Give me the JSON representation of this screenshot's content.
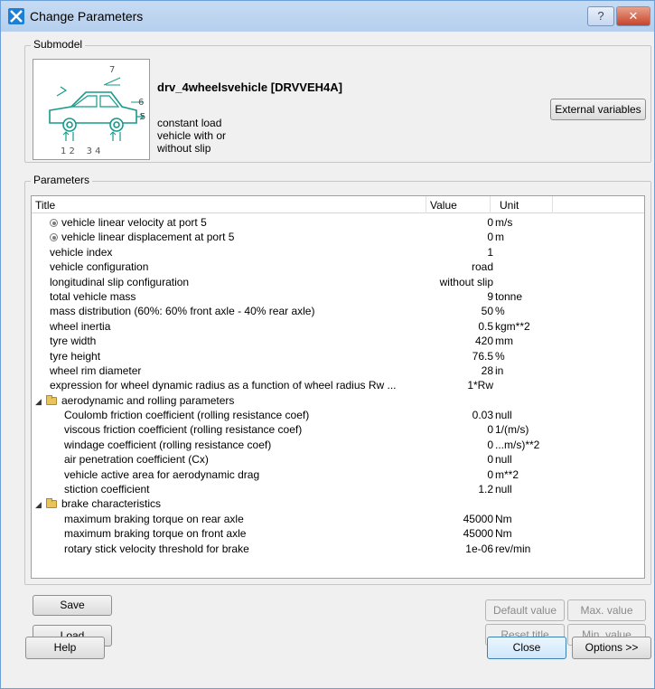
{
  "window": {
    "title": "Change Parameters",
    "help_label": "?",
    "close_label": "✕"
  },
  "submodel": {
    "group_label": "Submodel",
    "name": "drv_4wheelsvehicle [DRVVEH4A]",
    "description": [
      "constant load",
      "vehicle with or",
      "without slip"
    ],
    "diagram_labels": {
      "p7": "7",
      "p6": "6",
      "p5": "5",
      "bottom": "1 2    3 4"
    },
    "external_variables_label": "External variables"
  },
  "parameters": {
    "group_label": "Parameters",
    "columns": {
      "title": "Title",
      "value": "Value",
      "unit": "Unit"
    },
    "rows": [
      {
        "title": "vehicle linear velocity at port 5",
        "value": "0",
        "unit": "m/s",
        "icon": "radio",
        "indent": 1
      },
      {
        "title": "vehicle linear displacement at port 5",
        "value": "0",
        "unit": "m",
        "icon": "radio",
        "indent": 1
      },
      {
        "title": "vehicle index",
        "value": "1",
        "unit": "",
        "indent": 1
      },
      {
        "title": "vehicle configuration",
        "value": "road",
        "unit": "",
        "indent": 1
      },
      {
        "title": "longitudinal slip configuration",
        "value": "without slip",
        "unit": "",
        "indent": 1
      },
      {
        "title": "total vehicle mass",
        "value": "9",
        "unit": "tonne",
        "indent": 1
      },
      {
        "title": "mass distribution (60%: 60% front axle - 40% rear axle)",
        "value": "50",
        "unit": "%",
        "indent": 1
      },
      {
        "title": "wheel inertia",
        "value": "0.5",
        "unit": "kgm**2",
        "indent": 1
      },
      {
        "title": "tyre width",
        "value": "420",
        "unit": "mm",
        "indent": 1
      },
      {
        "title": "tyre height",
        "value": "76.5",
        "unit": "%",
        "indent": 1
      },
      {
        "title": "wheel rim diameter",
        "value": "28",
        "unit": "in",
        "indent": 1
      },
      {
        "title": "expression for wheel dynamic radius as a function of wheel radius Rw ...",
        "value": "1*Rw",
        "unit": "",
        "indent": 1
      },
      {
        "title": "aerodynamic and rolling parameters",
        "value": "",
        "unit": "",
        "icon": "folder",
        "category": true
      },
      {
        "title": "Coulomb friction coefficient (rolling resistance coef)",
        "value": "0.03",
        "unit": "null",
        "indent": 2
      },
      {
        "title": "viscous friction coefficient (rolling resistance coef)",
        "value": "0",
        "unit": "1/(m/s)",
        "indent": 2
      },
      {
        "title": "windage coefficient (rolling resistance coef)",
        "value": "0",
        "unit": "...m/s)**2",
        "indent": 2
      },
      {
        "title": "air penetration coefficient (Cx)",
        "value": "0",
        "unit": "null",
        "indent": 2
      },
      {
        "title": "vehicle active area for aerodynamic drag",
        "value": "0",
        "unit": "m**2",
        "indent": 2
      },
      {
        "title": "stiction coefficient",
        "value": "1.2",
        "unit": "null",
        "indent": 2
      },
      {
        "title": "brake characteristics",
        "value": "",
        "unit": "",
        "icon": "folder",
        "category": true
      },
      {
        "title": "maximum braking torque on rear axle",
        "value": "45000",
        "unit": "Nm",
        "indent": 2
      },
      {
        "title": "maximum braking torque on front axle",
        "value": "45000",
        "unit": "Nm",
        "indent": 2
      },
      {
        "title": "rotary stick velocity threshold for brake",
        "value": "1e-06",
        "unit": "rev/min",
        "indent": 2
      }
    ]
  },
  "buttons": {
    "save": "Save",
    "load": "Load",
    "default_value": "Default value",
    "max_value": "Max. value",
    "reset_title": "Reset title",
    "min_value": "Min. value",
    "help": "Help",
    "close": "Close",
    "options": "Options >>"
  }
}
